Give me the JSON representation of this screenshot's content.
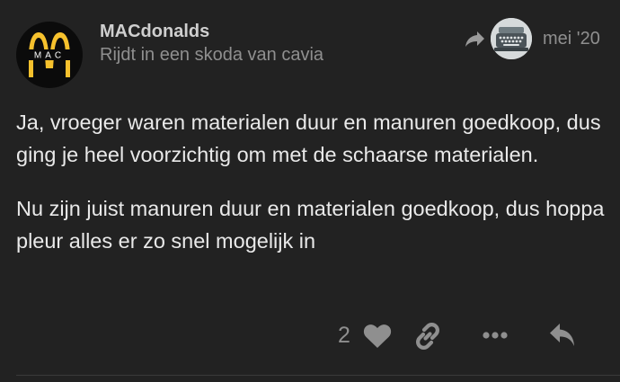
{
  "post": {
    "username": "MACdonalds",
    "user_title": "Rijdt in een skoda van cavia",
    "date": "mei '20",
    "paragraphs": [
      "Ja, vroeger waren materialen duur en manuren goedkoop, dus ging je heel voorzichtig om met de schaarse materialen.",
      "Nu zijn juist manuren duur en materialen goedkoop, dus hoppa pleur alles er zo snel mogelijk in"
    ],
    "like_count": "2"
  },
  "avatar": {
    "logo_text": "MAC",
    "arch_color": "#f6c12d"
  },
  "icons": {
    "reply_to": "reply-arrow-icon",
    "like": "heart-icon",
    "share": "link-icon",
    "more": "ellipsis-icon",
    "reply": "reply-icon"
  },
  "colors": {
    "background": "#222222",
    "text": "#e9e9e9",
    "muted": "#8f8f8f"
  }
}
